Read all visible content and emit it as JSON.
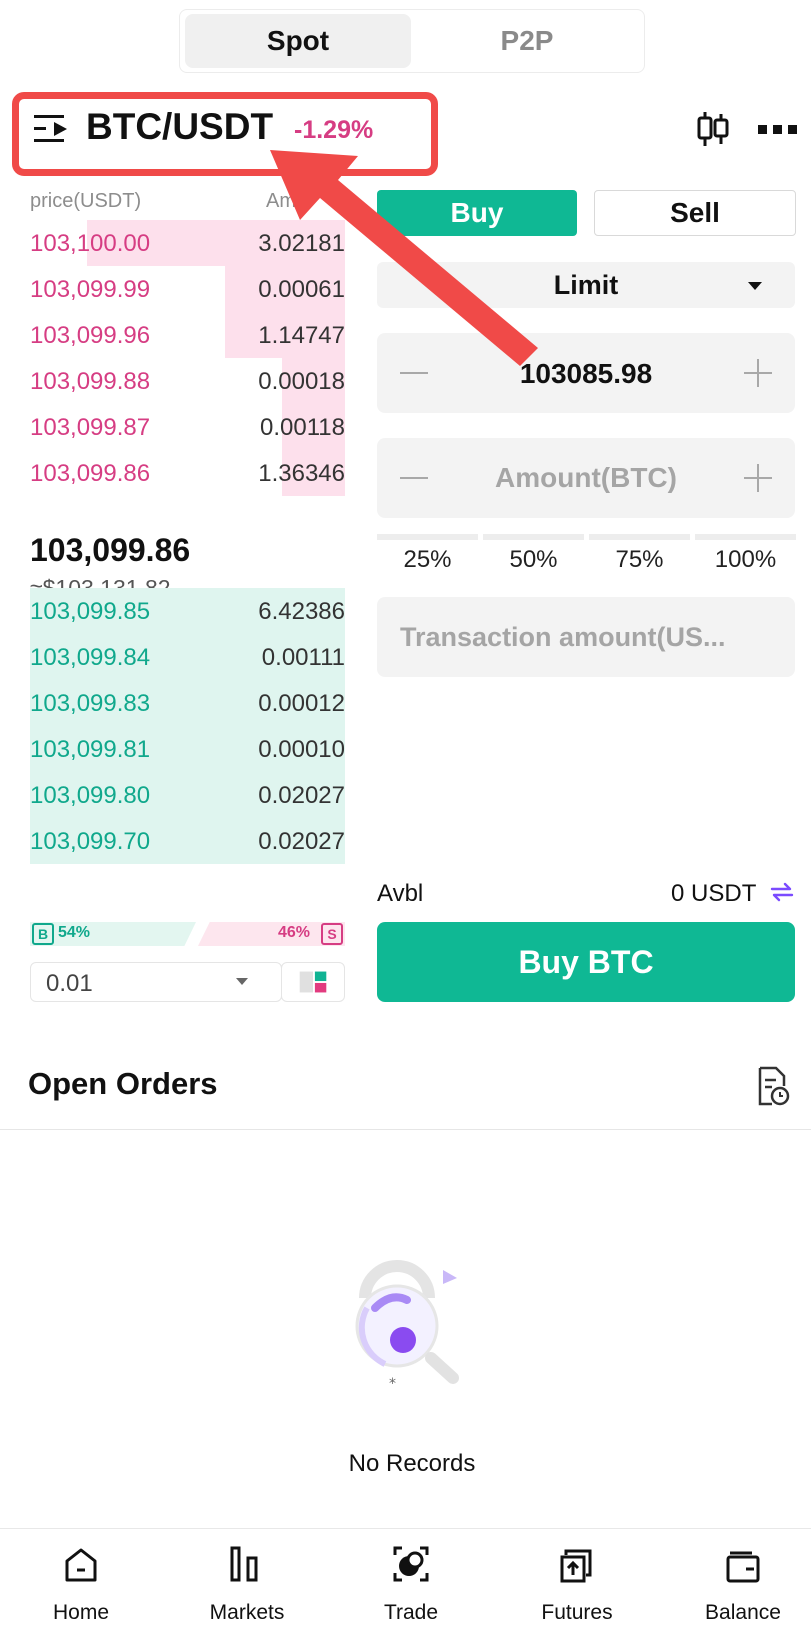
{
  "top_tabs": {
    "spot": "Spot",
    "p2p": "P2P"
  },
  "header": {
    "pair": "BTC/USDT",
    "change": "-1.29%"
  },
  "orderbook": {
    "price_header": "price(USDT)",
    "amount_header": "Am",
    "asks": [
      {
        "price": "103,100.00",
        "amount": "3.02181",
        "depth": 0.82
      },
      {
        "price": "103,099.99",
        "amount": "0.00061",
        "depth": 0.38
      },
      {
        "price": "103,099.96",
        "amount": "1.14747",
        "depth": 0.38
      },
      {
        "price": "103,099.88",
        "amount": "0.00018",
        "depth": 0.2
      },
      {
        "price": "103,099.87",
        "amount": "0.00118",
        "depth": 0.2
      },
      {
        "price": "103,099.86",
        "amount": "1.36346",
        "depth": 0.2
      }
    ],
    "last_price": "103,099.86",
    "last_price_usd": "≈$103,131.82",
    "bids": [
      {
        "price": "103,099.85",
        "amount": "6.42386",
        "depth": 1.0
      },
      {
        "price": "103,099.84",
        "amount": "0.00111",
        "depth": 1.0
      },
      {
        "price": "103,099.83",
        "amount": "0.00012",
        "depth": 1.0
      },
      {
        "price": "103,099.81",
        "amount": "0.00010",
        "depth": 1.0
      },
      {
        "price": "103,099.80",
        "amount": "0.02027",
        "depth": 1.0
      },
      {
        "price": "103,099.70",
        "amount": "0.02027",
        "depth": 1.0
      }
    ],
    "ratio": {
      "buy_label": "B",
      "buy_pct": "54%",
      "sell_label": "S",
      "sell_pct": "46%"
    },
    "depth_precision": "0.01"
  },
  "trade": {
    "buy_tab": "Buy",
    "sell_tab": "Sell",
    "order_type": "Limit",
    "price_value": "103085.98",
    "amount_placeholder": "Amount(BTC)",
    "percentages": [
      "25%",
      "50%",
      "75%",
      "100%"
    ],
    "total_placeholder": "Transaction amount(US...",
    "avbl_label": "Avbl",
    "avbl_value": "0 USDT",
    "buy_button": "Buy BTC"
  },
  "open_orders": {
    "title": "Open Orders",
    "empty_text": "No Records"
  },
  "nav": [
    {
      "label": "Home",
      "icon": "home-icon"
    },
    {
      "label": "Markets",
      "icon": "markets-icon"
    },
    {
      "label": "Trade",
      "icon": "trade-icon"
    },
    {
      "label": "Futures",
      "icon": "futures-icon"
    },
    {
      "label": "Balance",
      "icon": "wallet-icon"
    }
  ],
  "colors": {
    "buy": "#0fb894",
    "sell": "#d63d83",
    "highlight": "#f04a48"
  }
}
